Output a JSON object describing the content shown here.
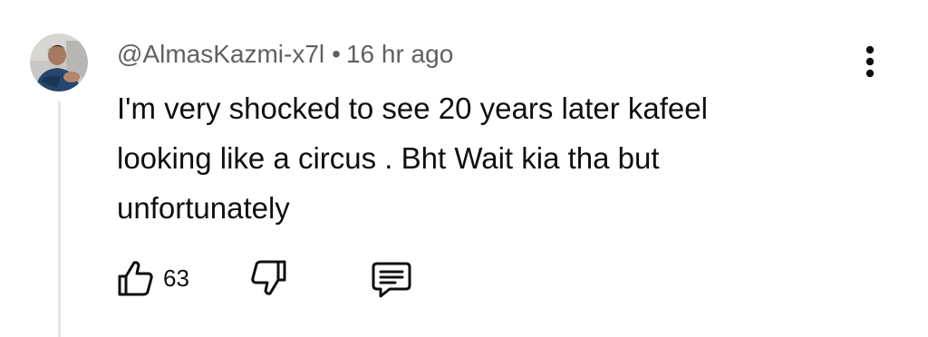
{
  "comment": {
    "author": "@AlmasKazmi-x7l",
    "separator": "•",
    "time": "16 hr ago",
    "text": "I'm very shocked to see 20 years later kafeel looking like a circus . Bht Wait kia tha but unfortunately",
    "likes": "63"
  },
  "icons": {
    "like": "thumb-up-icon",
    "dislike": "thumb-down-icon",
    "reply": "reply-comment-icon",
    "menu": "more-vertical-icon"
  },
  "colors": {
    "text": "#0f0f0f",
    "meta": "#606060",
    "thread_line": "#e5e5e5"
  }
}
